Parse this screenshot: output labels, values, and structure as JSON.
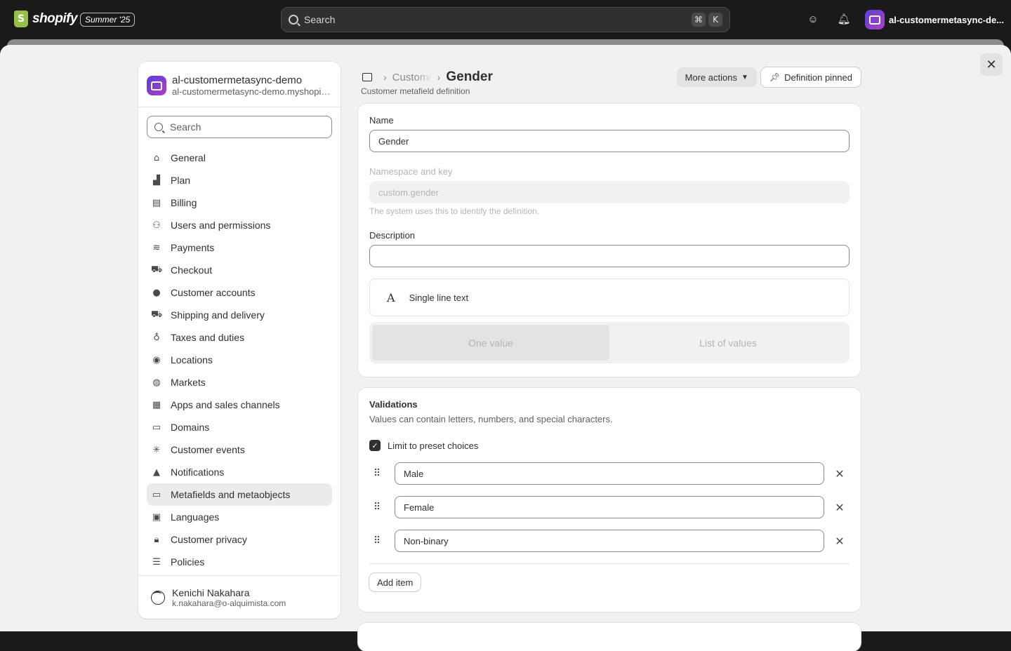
{
  "topbar": {
    "brand": "shopify",
    "edition": "Summer '25",
    "search_placeholder": "Search",
    "shortcut_cmd": "⌘",
    "shortcut_key": "K",
    "store_name": "al-customermetasync-de..."
  },
  "nav": {
    "store_name": "al-customermetasync-demo",
    "store_domain": "al-customermetasync-demo.myshopify.com",
    "search_placeholder": "Search",
    "items": [
      {
        "label": "General",
        "icon": "store-icon"
      },
      {
        "label": "Plan",
        "icon": "plan-icon"
      },
      {
        "label": "Billing",
        "icon": "billing-icon"
      },
      {
        "label": "Users and permissions",
        "icon": "users-icon"
      },
      {
        "label": "Payments",
        "icon": "payments-icon"
      },
      {
        "label": "Checkout",
        "icon": "cart-icon"
      },
      {
        "label": "Customer accounts",
        "icon": "person-icon"
      },
      {
        "label": "Shipping and delivery",
        "icon": "truck-icon"
      },
      {
        "label": "Taxes and duties",
        "icon": "tax-icon"
      },
      {
        "label": "Locations",
        "icon": "location-icon"
      },
      {
        "label": "Markets",
        "icon": "globe-icon"
      },
      {
        "label": "Apps and sales channels",
        "icon": "apps-icon"
      },
      {
        "label": "Domains",
        "icon": "domain-icon"
      },
      {
        "label": "Customer events",
        "icon": "cursor-icon"
      },
      {
        "label": "Notifications",
        "icon": "bell-icon"
      },
      {
        "label": "Metafields and metaobjects",
        "icon": "metafield-icon"
      },
      {
        "label": "Languages",
        "icon": "language-icon"
      },
      {
        "label": "Customer privacy",
        "icon": "lock-icon"
      },
      {
        "label": "Policies",
        "icon": "policy-icon"
      }
    ],
    "active_item": "Metafields and metaobjects",
    "user_name": "Kenichi Nakahara",
    "user_email": "k.nakahara@o-alquimista.com"
  },
  "header": {
    "breadcrumb_parent": "Customers",
    "title": "Gender",
    "subtitle": "Customer metafield definition",
    "more_actions": "More actions",
    "pin_button": "Definition pinned"
  },
  "definition": {
    "name_label": "Name",
    "name_value": "Gender",
    "namespace_label": "Namespace and key",
    "namespace_value": "custom.gender",
    "namespace_help": "The system uses this to identify the definition.",
    "description_label": "Description",
    "description_value": "",
    "type_icon_glyph": "A",
    "type_label": "Single line text",
    "value_options": [
      "One value",
      "List of values"
    ],
    "selected_value_option": "One value"
  },
  "validations": {
    "title": "Validations",
    "description": "Values can contain letters, numbers, and special characters.",
    "limit_label": "Limit to preset choices",
    "limit_checked": true,
    "choices": [
      "Male",
      "Female",
      "Non-binary"
    ],
    "add_item": "Add item"
  },
  "colors": {
    "topbar_bg": "#1a1a1a",
    "sheet_bg": "#f1f1f1",
    "card_bg": "#ffffff",
    "active_nav_bg": "#ebebeb"
  }
}
